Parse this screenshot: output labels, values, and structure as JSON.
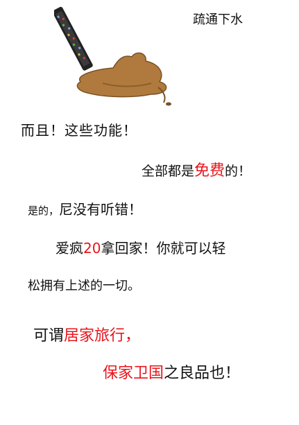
{
  "caption_top": "疏通下水",
  "lines": [
    {
      "text": "而且！这些功能！"
    },
    {
      "before": "全部都是",
      "highlight": "免费",
      "after": "的！"
    },
    {
      "before": "是的，",
      "after": "尼没有听错！"
    },
    {
      "before": "爱疯",
      "highlight": "20",
      "after": "拿回家！你就可以轻"
    },
    {
      "text": "松拥有上述的一切。"
    },
    {
      "before": "可谓",
      "highlight": "居家旅行，"
    },
    {
      "highlight": "保家卫国",
      "after": "之良品也！"
    }
  ],
  "colors": {
    "highlight": "#e8141b",
    "text": "#111111",
    "mud": "#b07a3e"
  },
  "illustration": {
    "icon": "phone-in-mud-icon"
  }
}
